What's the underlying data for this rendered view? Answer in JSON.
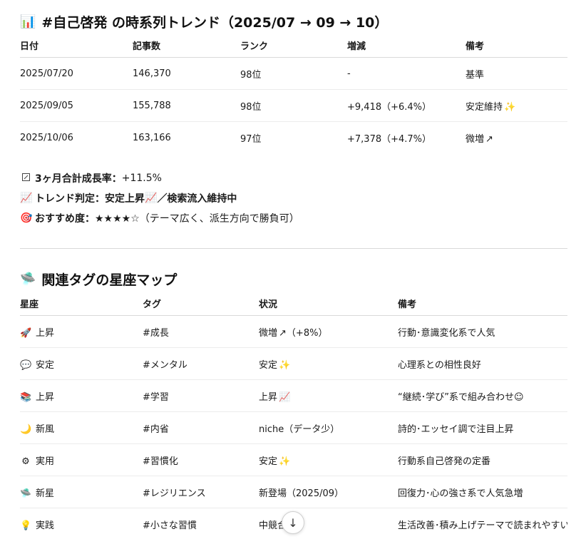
{
  "section1": {
    "icon": "📊",
    "title": "#自己啓発 の時系列トレンド（2025/07 → 09 → 10）",
    "headers": [
      "日付",
      "記事数",
      "ランク",
      "増減",
      "備考"
    ],
    "rows": [
      {
        "date": "2025/07/20",
        "count": "146,370",
        "rank": "98位",
        "change": "-",
        "note": "基準",
        "note_emoji": ""
      },
      {
        "date": "2025/09/05",
        "count": "155,788",
        "rank": "98位",
        "change": "+9,418（+6.4%）",
        "note": "安定維持",
        "note_emoji": "✨"
      },
      {
        "date": "2025/10/06",
        "count": "163,166",
        "rank": "97位",
        "change": "+7,378（+4.7%）",
        "note": "微増",
        "note_emoji": "↗"
      }
    ]
  },
  "summary": {
    "line1_label": "3ヶ月合計成長率：",
    "line1_value": "+11.5%",
    "line2_icon": "📈",
    "line2_label": "トレンド判定：安定上昇",
    "line2_icon2": "📈",
    "line2_value": "／検索流入維持中",
    "line3_icon": "🎯",
    "line3_label": "おすすめ度：",
    "line3_value": "★★★★☆（テーマ広く、派生方向で勝負可）"
  },
  "section2": {
    "icon": "🛸",
    "title": "関連タグの星座マップ",
    "headers": [
      "星座",
      "タグ",
      "状況",
      "備考"
    ],
    "rows": [
      {
        "icon": "🚀",
        "star": "上昇",
        "tag": "#成長",
        "status": "微増",
        "status_emoji": "↗",
        "status_extra": "（+8%）",
        "note": "行動･意識変化系で人気"
      },
      {
        "icon": "💬",
        "star": "安定",
        "tag": "#メンタル",
        "status": "安定",
        "status_emoji": "✨",
        "status_extra": "",
        "note": "心理系との相性良好"
      },
      {
        "icon": "📚",
        "star": "上昇",
        "tag": "#学習",
        "status": "上昇",
        "status_emoji": "📈",
        "status_extra": "",
        "note": "“継続･学び”系で組み合わせ☺"
      },
      {
        "icon": "🌙",
        "star": "新風",
        "tag": "#内省",
        "status": "niche（データ少）",
        "status_emoji": "",
        "status_extra": "",
        "note": "詩的･エッセイ調で注目上昇"
      },
      {
        "icon": "⚙",
        "star": "実用",
        "tag": "#習慣化",
        "status": "安定",
        "status_emoji": "✨",
        "status_extra": "",
        "note": "行動系自己啓発の定番"
      },
      {
        "icon": "🛸",
        "star": "新星",
        "tag": "#レジリエンス",
        "status": "新登場（2025/09）",
        "status_emoji": "",
        "status_extra": "",
        "note": "回復力･心の強さ系で人気急増"
      },
      {
        "icon": "💡",
        "star": "実践",
        "tag": "#小さな習慣",
        "status": "中競合",
        "status_emoji": "",
        "status_extra": "",
        "note": "生活改善･積み上げテーマで読まれやすい"
      }
    ]
  },
  "scroll_button": {
    "icon": "↓"
  }
}
